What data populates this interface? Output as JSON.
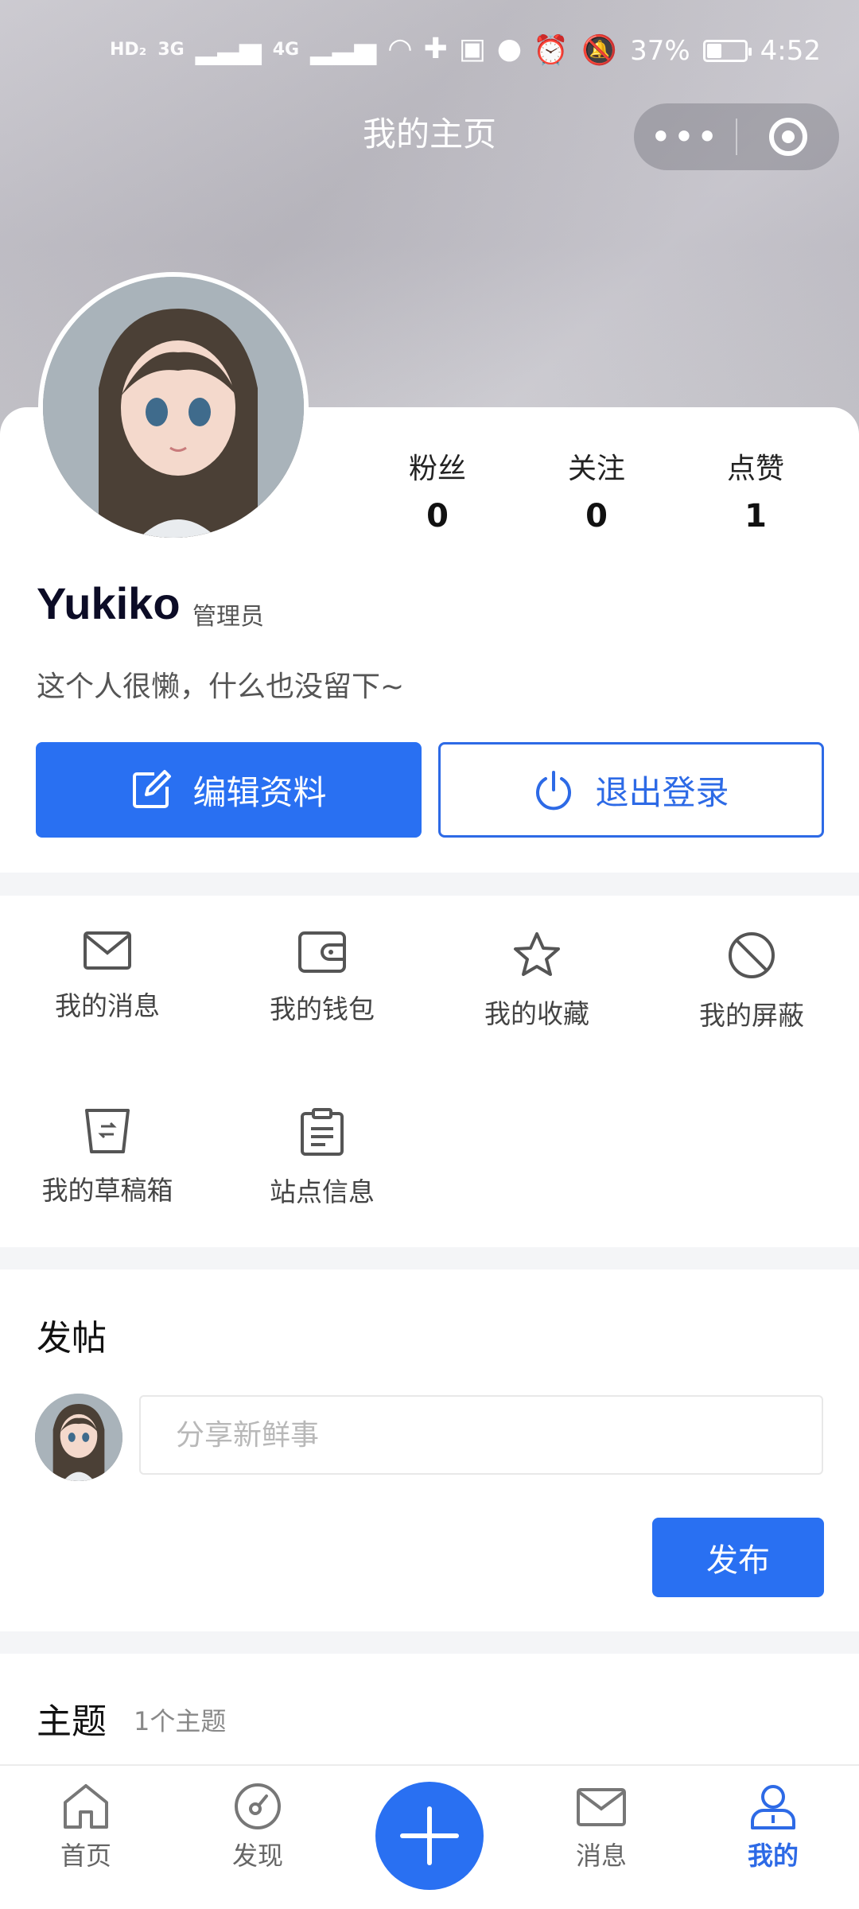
{
  "status_bar": {
    "left_chips": [
      "HD₂",
      "3G",
      "4G"
    ],
    "battery_percent": "37%",
    "time": "4:52"
  },
  "header": {
    "title": "我的主页",
    "capsule_more_icon": "more-dots-icon",
    "capsule_close_icon": "target-close-icon"
  },
  "profile": {
    "username": "Yukiko",
    "role": "管理员",
    "bio": "这个人很懒，什么也没留下~",
    "stats": [
      {
        "label": "粉丝",
        "value": "0"
      },
      {
        "label": "关注",
        "value": "0"
      },
      {
        "label": "点赞",
        "value": "1"
      }
    ],
    "edit_label": "编辑资料",
    "logout_label": "退出登录"
  },
  "menu": {
    "items": [
      {
        "label": "我的消息",
        "icon": "envelope-icon"
      },
      {
        "label": "我的钱包",
        "icon": "wallet-icon"
      },
      {
        "label": "我的收藏",
        "icon": "star-icon"
      },
      {
        "label": "我的屏蔽",
        "icon": "block-icon"
      },
      {
        "label": "我的草稿箱",
        "icon": "drafts-bin-icon"
      },
      {
        "label": "站点信息",
        "icon": "clipboard-icon"
      }
    ]
  },
  "composer": {
    "title": "发帖",
    "placeholder": "分享新鲜事",
    "publish_label": "发布"
  },
  "topics": {
    "title": "主题",
    "count_label": "1个主题"
  },
  "tabbar": {
    "items": [
      {
        "label": "首页",
        "icon": "home-icon",
        "active": false
      },
      {
        "label": "发现",
        "icon": "compass-icon",
        "active": false
      },
      {
        "label": "消息",
        "icon": "mail-icon",
        "active": false
      },
      {
        "label": "我的",
        "icon": "user-icon",
        "active": true
      }
    ],
    "fab_icon": "plus-icon"
  },
  "colors": {
    "accent": "#2970f2",
    "outline_accent": "#2d6ae6",
    "page_bg": "#f4f5f7"
  }
}
